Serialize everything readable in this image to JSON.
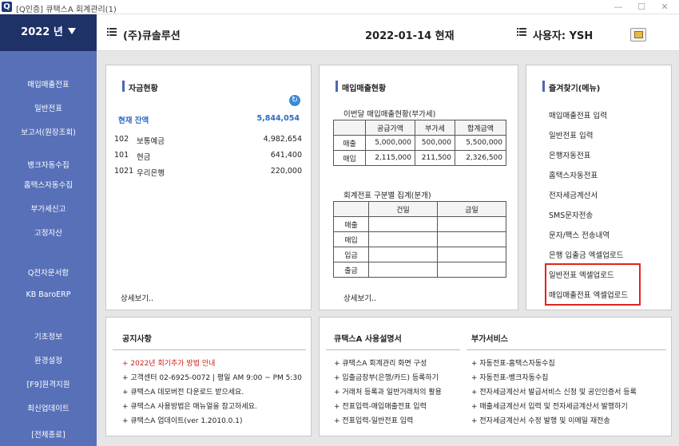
{
  "window": {
    "title": "[Q인증] 큐택스A   회계관리(1)",
    "icon_letter": "Q",
    "controls": [
      "—",
      "☐",
      "✕"
    ]
  },
  "sidebar": {
    "year_label": "2022 년",
    "items": [
      {
        "label": "매입매출전표"
      },
      {
        "label": "일반전표"
      },
      {
        "label": "보고서(원장조회)"
      },
      {
        "label": "뱅크자동수집"
      },
      {
        "label": "홈택스자동수집"
      },
      {
        "label": "부가세신고"
      },
      {
        "label": "고정자산"
      },
      {
        "label": "Q전자문서함"
      },
      {
        "label": "KB BaroERP"
      },
      {
        "label": "기초정보"
      },
      {
        "label": "환경설정"
      },
      {
        "label": "[F9]원격지원"
      },
      {
        "label": "최신업데이트"
      },
      {
        "label": "[전체종료]"
      }
    ]
  },
  "header": {
    "company": "(주)큐솔루션",
    "date_text": "2022-01-14 현재",
    "user_text": "사용자: YSH"
  },
  "funds": {
    "title": "자금현황",
    "total_label": "현재 잔액",
    "total_value": "5,844,054",
    "accounts": [
      {
        "code": "102",
        "name": "보통예금",
        "amount": "4,982,654"
      },
      {
        "code": "101",
        "name": "현금",
        "amount": "641,400"
      },
      {
        "code": "1021",
        "name": "우리은행",
        "amount": "220,000"
      }
    ],
    "detail": "상세보기.."
  },
  "sales": {
    "title": "매입매출현황",
    "vat_title": "이번달 매입매출현황(부가세)",
    "vat_headers": [
      "",
      "공급가액",
      "부가세",
      "합계금액"
    ],
    "vat_rows": [
      [
        "매출",
        "5,000,000",
        "500,000",
        "5,500,000"
      ],
      [
        "매입",
        "2,115,000",
        "211,500",
        "2,326,500"
      ]
    ],
    "slip_title": "회계전표 구분별 집계(분개)",
    "slip_headers": [
      "",
      "건일",
      "금일"
    ],
    "slip_rows": [
      [
        "매출",
        "",
        ""
      ],
      [
        "매입",
        "",
        ""
      ],
      [
        "입금",
        "",
        ""
      ],
      [
        "출금",
        "",
        ""
      ]
    ],
    "detail": "상세보기.."
  },
  "favorites": {
    "title": "즐겨찾기(메뉴)",
    "items": [
      "매입매출전표 입력",
      "일반전표 입력",
      "은행자동전표",
      "홈택스자동전표",
      "전자세금계산서",
      "SMS문자전송",
      "문자/팩스 전송내역",
      "은행 입출금 엑셀업로드",
      "일반전표 엑셀업로드",
      "매입매출전표 엑셀업로드"
    ],
    "highlight_color": "#e0251b"
  },
  "notice": {
    "title": "공지사항",
    "items": [
      {
        "text": "+ 2022년 회기추가 방법 안내",
        "red": true
      },
      {
        "text": "+ 고객센터 02-6925-0072 | 평일 AM 9:00 ~ PM 5:30",
        "red": false
      },
      {
        "text": "+ 큐택스A 데모버전 다운로드 받으세요.",
        "red": false
      },
      {
        "text": "+ 큐택스A 사용방법은 매뉴얼을 참고하세요.",
        "red": false
      },
      {
        "text": "+ 큐택스A 업데이트(ver 1.2010.0.1)",
        "red": false
      }
    ]
  },
  "manual": {
    "title": "큐택스A 사용설명서",
    "items": [
      "+ 큐택스A 회계관리 화면 구성",
      "+ 입출금장부(은행/카드) 등록하기",
      "+ 거래처 등록과 일반거래처의 활용",
      "+ 전표입력-매입매출전표 입력",
      "+ 전표입력-일반전표 입력"
    ]
  },
  "addon": {
    "title": "부가서비스",
    "items": [
      "+ 자동전표-홈택스자동수집",
      "+ 자동전표-뱅크자동수집",
      "+ 전자세금계산서 발급서비스 신청 및 공인인증서 등록",
      "+ 매출세금계산서 입력 및 전자세금계산서 발행하기",
      "+ 전자세금계산서 수정 발행 및 이메일 재전송"
    ]
  },
  "colors": {
    "sidebar_bg": "#5770b8",
    "year_bg": "#1f3267",
    "accent": "#4d67b0",
    "total_color": "#2b6cc4",
    "notice_red": "#d0201a"
  }
}
